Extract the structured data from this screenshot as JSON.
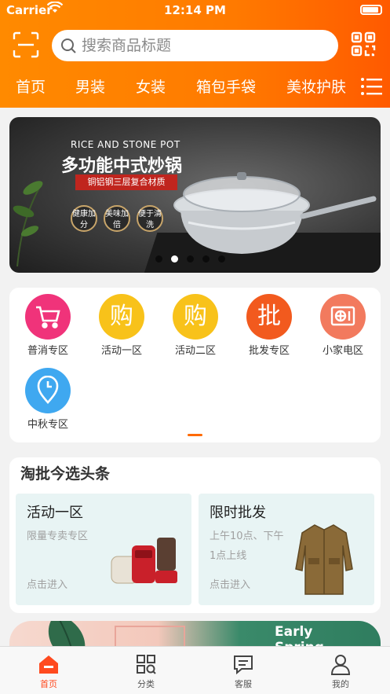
{
  "status_bar": {
    "carrier": "Carrier",
    "time": "12:14 PM"
  },
  "search": {
    "placeholder": "搜索商品标题"
  },
  "nav_tabs": [
    "首页",
    "男装",
    "女装",
    "箱包手袋",
    "美妆护肤"
  ],
  "banner": {
    "subtitle": "RICE AND STONE POT",
    "title": "多功能中式炒锅",
    "ribbon": "铜铝钢三层复合材质",
    "bubbles": [
      "健康加分",
      "美味加倍",
      "便于清洗"
    ],
    "slide_count": 5,
    "active_slide": 1
  },
  "categories": [
    {
      "label": "普消专区",
      "glyph": "",
      "icon": "cart-icon",
      "color": "#f0337a"
    },
    {
      "label": "活动一区",
      "glyph": "购",
      "icon": "buy-icon",
      "color": "#f8c21a"
    },
    {
      "label": "活动二区",
      "glyph": "购",
      "icon": "buy-icon",
      "color": "#f8c21a"
    },
    {
      "label": "批发专区",
      "glyph": "批",
      "icon": "wholesale-icon",
      "color": "#f25a1e"
    },
    {
      "label": "小家电区",
      "glyph": "",
      "icon": "appliance-icon",
      "color": "#f27a5e"
    },
    {
      "label": "中秋专区",
      "glyph": "",
      "icon": "location-icon",
      "color": "#3fa8f0"
    }
  ],
  "headlines": {
    "title": "淘批今选头条",
    "cards": [
      {
        "title": "活动一区",
        "subtitle": "限量专卖专区",
        "link": "点击进入"
      },
      {
        "title": "限时批发",
        "subtitle": "上午10点、下午1点上线",
        "link": "点击进入"
      }
    ]
  },
  "promo": {
    "text_line1": "Early",
    "text_line2": "Spring"
  },
  "tabbar": [
    {
      "label": "首页",
      "active": true
    },
    {
      "label": "分类",
      "active": false
    },
    {
      "label": "客服",
      "active": false
    },
    {
      "label": "我的",
      "active": false
    }
  ],
  "colors": {
    "accent": "#ff7a00",
    "tab_active": "#ff4a1f"
  }
}
